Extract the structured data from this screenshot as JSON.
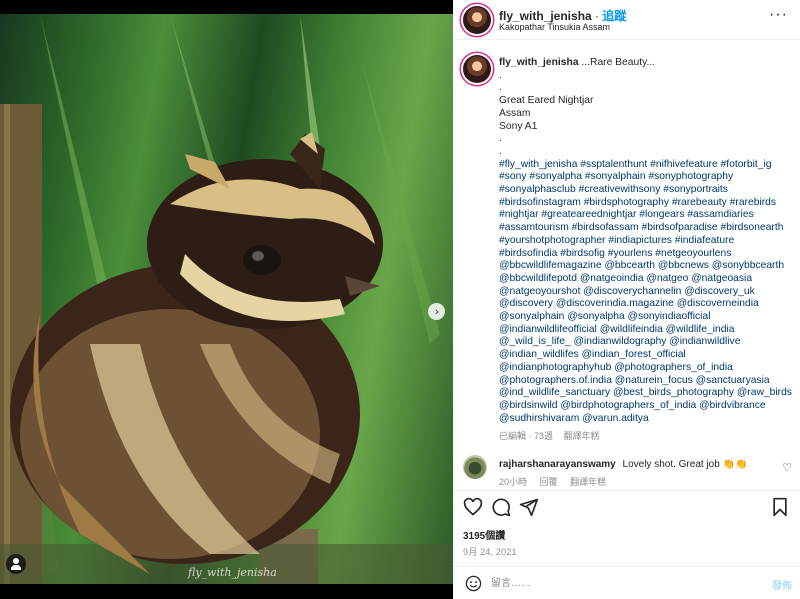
{
  "post": {
    "username": "fly_with_jenisha",
    "follow_label": "追蹤",
    "location": "Kakopathar Tinsukia Assam",
    "more_icon": "more-horizontal-icon",
    "image_watermark": "fly_with_jenisha"
  },
  "caption": {
    "username": "fly_with_jenisha",
    "lines": [
      "...Rare Beauty...",
      ".",
      ".",
      "Great Eared Nightjar",
      "Assam",
      "Sony A1",
      ".",
      ".",
      "#fly_with_jenisha #ssptalenthunt #nifhivefeature #fotorbit_ig",
      "#sony #sonyalpha #sonyalphain #sonyphotography",
      "#sonyalphasclub #creativewithsony #sonyportraits",
      "#birdsofinstagram #birdsphotography #rarebeauty #rarebirds",
      "#nightjar #greateareednightjar #longears #assamdiaries",
      "#assamtourism #birdsofassam #birdsofparadise #birdsonearth",
      "#yourshotphotographer #indiapictures #indiafeature",
      "#birdsofindia #birdsofig #yourlens #netgeoyourlens",
      "@bbcwildlifemagazine @bbcearth @bbcnews @sonybbcearth",
      "@bbcwildlifepotd @natgeoindia @natgeo @natgeoasia",
      "@natgeoyourshot @discoverychannelin @discovery_uk",
      "@discovery @discoverindia.magazine @discoverneindia",
      "@sonyalphain @sonyalpha @sonyindiaofficial",
      "@indianwildlifeofficial @wildlifeindia @wildlife_india",
      "@_wild_is_life_ @indianwildography @indianwildlive",
      "@indian_wildlifes @indian_forest_official",
      "@indianphotographyhub @photographers_of_india",
      "@photographers.of.india @naturein_focus @sanctuaryasia",
      "@ind_wildlife_sanctuary @best_birds_photography @raw_birds",
      "@birdsinwild @birdphotographers_of_india @birdvibrance",
      "@sudhirshivaram @varun.aditya"
    ],
    "edited_label": "已編輯",
    "age": "73週",
    "translate_label": "翻譯年糕"
  },
  "comment": {
    "username": "rajharshanarayanswamy",
    "text": "Lovely shot. Great job 👏👏",
    "age": "20小時",
    "reply_label": "回覆",
    "translate_label": "翻譯年糕"
  },
  "actions": {
    "likes": "3195個讚",
    "date": "9月 24, 2021"
  },
  "add_comment": {
    "placeholder": "留言……",
    "post_label": "發佈"
  }
}
